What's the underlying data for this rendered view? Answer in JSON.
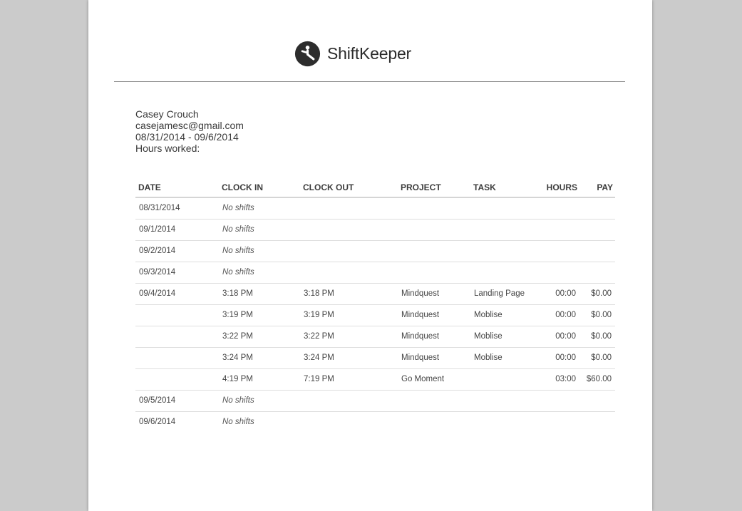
{
  "brand": {
    "name": "ShiftKeeper",
    "icon": "clock-person-icon"
  },
  "employee": {
    "name": "Casey Crouch",
    "email": "casejamesc@gmail.com",
    "date_range": "08/31/2014 - 09/6/2014",
    "hours_worked_label": "Hours worked:"
  },
  "table": {
    "headers": {
      "date": "DATE",
      "clock_in": "CLOCK IN",
      "clock_out": "CLOCK OUT",
      "project": "PROJECT",
      "task": "TASK",
      "hours": "HOURS",
      "pay": "PAY"
    },
    "rows": [
      {
        "date": "08/31/2014",
        "clock_in": "No shifts",
        "clock_out": "",
        "project": "",
        "task": "",
        "hours": "",
        "pay": "",
        "no_shift": true
      },
      {
        "date": "09/1/2014",
        "clock_in": "No shifts",
        "clock_out": "",
        "project": "",
        "task": "",
        "hours": "",
        "pay": "",
        "no_shift": true
      },
      {
        "date": "09/2/2014",
        "clock_in": "No shifts",
        "clock_out": "",
        "project": "",
        "task": "",
        "hours": "",
        "pay": "",
        "no_shift": true
      },
      {
        "date": "09/3/2014",
        "clock_in": "No shifts",
        "clock_out": "",
        "project": "",
        "task": "",
        "hours": "",
        "pay": "",
        "no_shift": true
      },
      {
        "date": "09/4/2014",
        "clock_in": "3:18 PM",
        "clock_out": "3:18 PM",
        "project": "Mindquest",
        "task": "Landing Page",
        "hours": "00:00",
        "pay": "$0.00",
        "no_shift": false
      },
      {
        "date": "",
        "clock_in": "3:19 PM",
        "clock_out": "3:19 PM",
        "project": "Mindquest",
        "task": "Moblise",
        "hours": "00:00",
        "pay": "$0.00",
        "no_shift": false
      },
      {
        "date": "",
        "clock_in": "3:22 PM",
        "clock_out": "3:22 PM",
        "project": "Mindquest",
        "task": "Moblise",
        "hours": "00:00",
        "pay": "$0.00",
        "no_shift": false
      },
      {
        "date": "",
        "clock_in": "3:24 PM",
        "clock_out": "3:24 PM",
        "project": "Mindquest",
        "task": "Moblise",
        "hours": "00:00",
        "pay": "$0.00",
        "no_shift": false
      },
      {
        "date": "",
        "clock_in": "4:19 PM",
        "clock_out": "7:19 PM",
        "project": "Go Moment",
        "task": "",
        "hours": "03:00",
        "pay": "$60.00",
        "no_shift": false
      },
      {
        "date": "09/5/2014",
        "clock_in": "No shifts",
        "clock_out": "",
        "project": "",
        "task": "",
        "hours": "",
        "pay": "",
        "no_shift": true
      },
      {
        "date": "09/6/2014",
        "clock_in": "No shifts",
        "clock_out": "",
        "project": "",
        "task": "",
        "hours": "",
        "pay": "",
        "no_shift": true
      }
    ]
  }
}
